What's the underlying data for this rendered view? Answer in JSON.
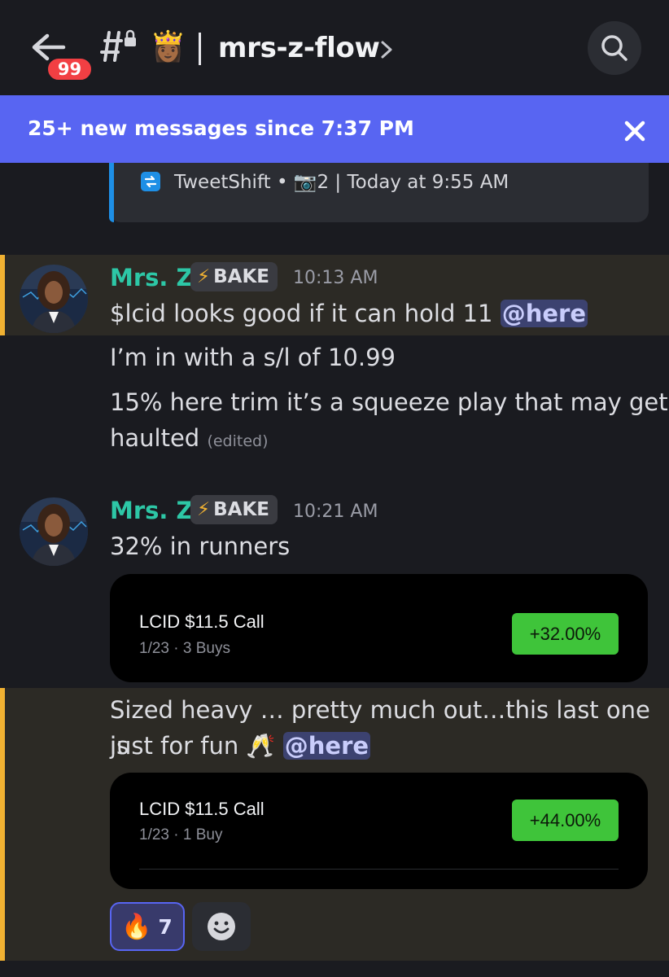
{
  "header": {
    "unread_count": "99",
    "channel_emoji": "👸🏾",
    "channel_name": "mrs-z-flow"
  },
  "banner": {
    "text": "25+ new messages since 7:37 PM"
  },
  "embed": {
    "footer": "TweetShift • 📷2 | Today at 9:55 AM"
  },
  "messages": [
    {
      "author": "Mrs. Z",
      "tag": "BAKE",
      "tag_icon": "⚡",
      "time": "10:13 AM",
      "line1": "$lcid looks good if it can hold 11",
      "mention": "@here",
      "line2": "I’m in with a s/l of 10.99",
      "line3a": "15% here trim it’s a squeeze play that may get",
      "line3b": "haulted",
      "edited": "(edited)"
    },
    {
      "author": "Mrs. Z",
      "tag": "BAKE",
      "tag_icon": "⚡",
      "time": "10:21 AM",
      "line1": "32% in runners",
      "card": {
        "title": "LCID $11.5 Call",
        "sub": "1/23 · 3 Buys",
        "pct": "+32.00%"
      },
      "line2a": "Sized heavy … pretty much out…this last one is",
      "line2b": "just for fun 🥂",
      "mention": "@here",
      "card2": {
        "title": "LCID $11.5 Call",
        "sub": "1/23 · 1 Buy",
        "pct": "+44.00%"
      }
    }
  ],
  "reactions": [
    {
      "emoji": "🔥",
      "count": "7"
    }
  ],
  "colors": {
    "accent": "#5865f2",
    "author": "#2dc7a6",
    "highlight_bar": "#f0b132",
    "gain": "#3fc43a"
  }
}
